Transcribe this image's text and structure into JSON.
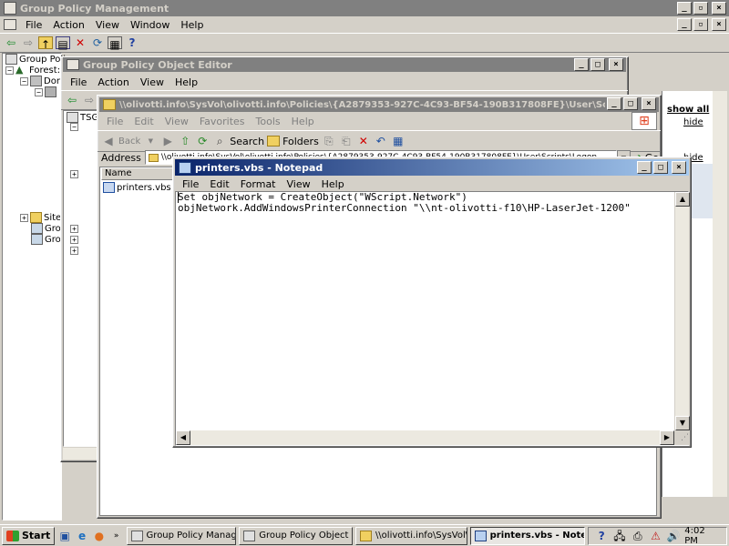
{
  "gpm": {
    "title": "Group Policy Management",
    "menus": [
      "File",
      "Action",
      "View",
      "Window",
      "Help"
    ],
    "tree": [
      "Group Policy",
      "Forest:",
      "Dom",
      "Sites",
      "Grou",
      "Grou"
    ],
    "right_links": {
      "show_all": "show all",
      "hide": "hide"
    }
  },
  "gpoe": {
    "title": "Group Policy Object Editor",
    "menus": [
      "File",
      "Action",
      "View",
      "Help"
    ],
    "tree_root": "TSG"
  },
  "explorer": {
    "title": "\\\\olivotti.info\\SysVol\\olivotti.info\\Policies\\{A2879353-927C-4C93-BF54-190B317808FE}\\User\\Scrip",
    "menus": [
      "File",
      "Edit",
      "View",
      "Favorites",
      "Tools",
      "Help"
    ],
    "toolbar": {
      "back": "Back",
      "search": "Search",
      "folders": "Folders"
    },
    "address_label": "Address",
    "address_value": "\\\\olivotti.info\\SysVol\\olivotti.info\\Policies\\{A2879353-927C-4C93-BF54-190B317808FE}\\User\\Scripts\\Logon",
    "go": "Go",
    "column_name": "Name",
    "files": [
      "printers.vbs"
    ]
  },
  "notepad": {
    "title": "printers.vbs - Notepad",
    "menus": [
      "File",
      "Edit",
      "Format",
      "View",
      "Help"
    ],
    "lines": [
      "Set objNetwork = CreateObject(\"WScript.Network\")",
      "objNetwork.AddWindowsPrinterConnection \"\\\\nt-olivotti-f10\\HP-LaserJet-1200\""
    ]
  },
  "taskbar": {
    "start": "Start",
    "tasks": [
      "Group Policy Management",
      "Group Policy Object Editor",
      "\\\\olivotti.info\\SysVol\\olivi...",
      "printers.vbs - Notepad"
    ],
    "clock": "4:02 PM"
  }
}
